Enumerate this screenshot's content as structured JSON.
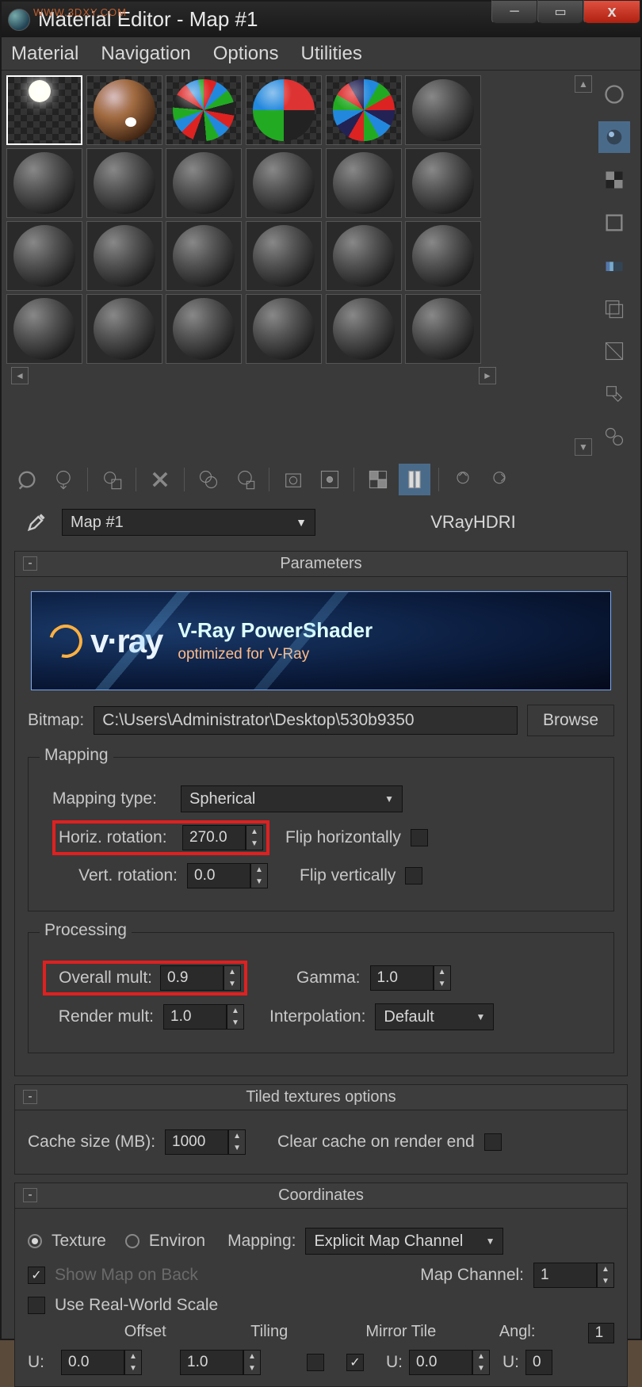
{
  "watermark": "WWW.3DXY.COM",
  "window": {
    "title": "Material Editor - Map #1"
  },
  "menu": {
    "material": "Material",
    "navigation": "Navigation",
    "options": "Options",
    "utilities": "Utilities"
  },
  "name_row": {
    "name": "Map #1",
    "type": "VRayHDRI"
  },
  "rollouts": {
    "parameters": {
      "title": "Parameters",
      "banner_title": "V-Ray PowerShader",
      "banner_sub": "optimized for V-Ray",
      "vray_txt": "v·ray",
      "bitmap_label": "Bitmap:",
      "bitmap_path": "C:\\Users\\Administrator\\Desktop\\530b9350",
      "browse": "Browse",
      "mapping_group": "Mapping",
      "mapping_type_label": "Mapping type:",
      "mapping_type_value": "Spherical",
      "horiz_label": "Horiz. rotation:",
      "horiz_value": "270.0",
      "flip_h": "Flip horizontally",
      "vert_label": "Vert. rotation:",
      "vert_value": "0.0",
      "flip_v": "Flip vertically",
      "processing_group": "Processing",
      "overall_label": "Overall mult:",
      "overall_value": "0.9",
      "gamma_label": "Gamma:",
      "gamma_value": "1.0",
      "render_label": "Render mult:",
      "render_value": "1.0",
      "interp_label": "Interpolation:",
      "interp_value": "Default"
    },
    "tiled": {
      "title": "Tiled textures options",
      "cache_label": "Cache size (MB):",
      "cache_value": "1000",
      "clear_label": "Clear cache on render end"
    },
    "coords": {
      "title": "Coordinates",
      "texture": "Texture",
      "environ": "Environ",
      "mapping_label": "Mapping:",
      "mapping_value": "Explicit Map Channel",
      "show_map": "Show Map on Back",
      "channel_label": "Map Channel:",
      "channel_value": "1",
      "real_world": "Use Real-World Scale",
      "h_offset": "Offset",
      "h_tiling": "Tiling",
      "h_mirror": "Mirror Tile",
      "h_angle": "Angl:",
      "angle_top": "1",
      "u_label": "U:",
      "u_offset": "0.0",
      "u_tiling": "1.0",
      "u_angle": "0.0",
      "u_last": "0"
    }
  }
}
